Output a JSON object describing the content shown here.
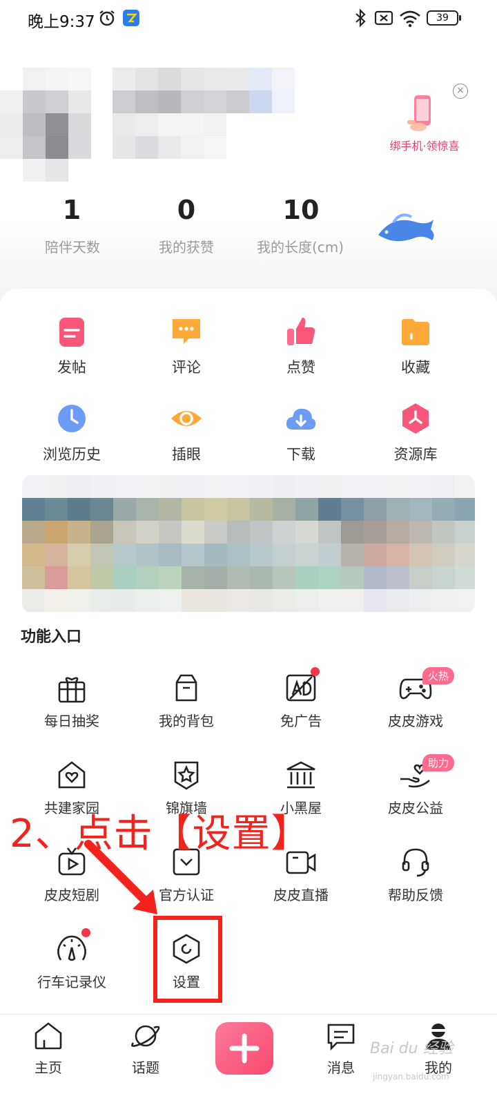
{
  "status_bar": {
    "time": "晚上9:37",
    "battery": "39"
  },
  "profile": {
    "bind_phone_label": "绑手机·领惊喜",
    "close_glyph": "×",
    "stats": [
      {
        "value": "1",
        "label": "陪伴天数"
      },
      {
        "value": "0",
        "label": "我的获赞"
      },
      {
        "value": "10",
        "label": "我的长度(cm)"
      }
    ]
  },
  "quick_grid": [
    {
      "label": "发帖",
      "icon": "post-icon"
    },
    {
      "label": "评论",
      "icon": "comment-icon"
    },
    {
      "label": "点赞",
      "icon": "like-icon"
    },
    {
      "label": "收藏",
      "icon": "folder-icon"
    },
    {
      "label": "浏览历史",
      "icon": "clock-icon"
    },
    {
      "label": "插眼",
      "icon": "eye-icon"
    },
    {
      "label": "下载",
      "icon": "download-cloud-icon"
    },
    {
      "label": "资源库",
      "icon": "resource-hex-icon"
    }
  ],
  "functions": {
    "title": "功能入口",
    "items": [
      {
        "label": "每日抽奖",
        "icon": "gift-icon"
      },
      {
        "label": "我的背包",
        "icon": "backpack-icon"
      },
      {
        "label": "免广告",
        "icon": "no-ad-icon"
      },
      {
        "label": "皮皮游戏",
        "icon": "gamepad-icon",
        "tag": "火热"
      },
      {
        "label": "共建家园",
        "icon": "home-heart-icon"
      },
      {
        "label": "锦旗墙",
        "icon": "star-badge-icon"
      },
      {
        "label": "小黑屋",
        "icon": "jail-building-icon"
      },
      {
        "label": "皮皮公益",
        "icon": "charity-hand-icon",
        "tag": "助力"
      },
      {
        "label": "皮皮短剧",
        "icon": "tv-play-icon"
      },
      {
        "label": "官方认证",
        "icon": "certified-icon"
      },
      {
        "label": "皮皮直播",
        "icon": "video-camera-icon"
      },
      {
        "label": "帮助反馈",
        "icon": "headset-icon"
      },
      {
        "label": "行车记录仪",
        "icon": "speedometer-icon"
      },
      {
        "label": "设置",
        "icon": "settings-hex-icon"
      }
    ]
  },
  "annotation": {
    "text": "2、点击【设置】",
    "color": "#f2231d"
  },
  "bottom_nav": [
    {
      "label": "主页",
      "icon": "home-icon"
    },
    {
      "label": "话题",
      "icon": "planet-icon"
    },
    {
      "label": "",
      "icon": "plus-icon"
    },
    {
      "label": "消息",
      "icon": "message-icon"
    },
    {
      "label": "我的",
      "icon": "profile-avatar-icon"
    }
  ],
  "watermark": {
    "brand": "Bai du 经验",
    "url": "jingyan.baidu.com"
  },
  "colors": {
    "accent_pink": "#f7496f",
    "tag_pink": "#ff6b8e",
    "notification_red": "#f0364b"
  }
}
